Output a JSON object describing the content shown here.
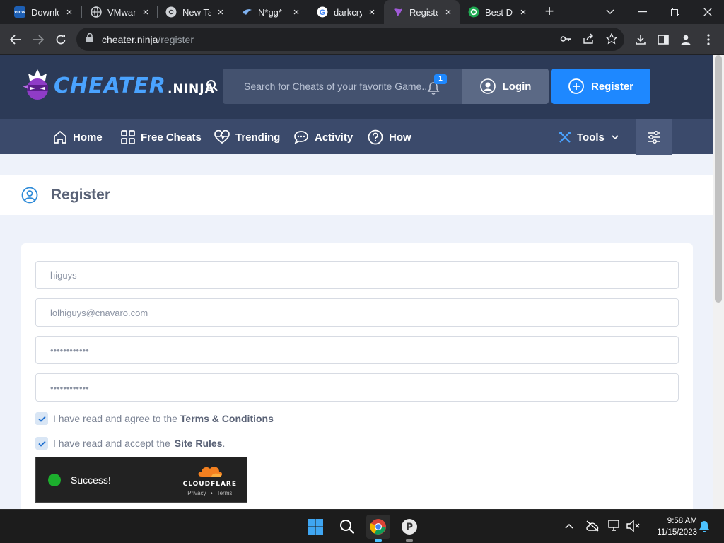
{
  "browser": {
    "tabs": [
      {
        "title": "Downlo",
        "favicon": "vmware-icon",
        "active": false
      },
      {
        "title": "VMwar",
        "favicon": "globe-icon",
        "active": false
      },
      {
        "title": "New Ta",
        "favicon": "chrome-icon",
        "active": false
      },
      {
        "title": "N*gg*",
        "favicon": "bird-icon",
        "active": false
      },
      {
        "title": "darkcry",
        "favicon": "google-icon",
        "active": false
      },
      {
        "title": "Registe",
        "favicon": "cheater-ninja-icon",
        "active": true
      },
      {
        "title": "Best Di",
        "favicon": "xbox-icon",
        "active": false
      }
    ],
    "url_host": "cheater.ninja",
    "url_path": "/register"
  },
  "site": {
    "logo_main": "CHEATER",
    "logo_sub": ".NINJA",
    "search_placeholder": "Search for Cheats of your favorite Game...",
    "notification_count": "1",
    "login_label": "Login",
    "register_label": "Register",
    "nav": [
      {
        "label": "Home",
        "icon": "home-icon"
      },
      {
        "label": "Free Cheats",
        "icon": "grid-icon"
      },
      {
        "label": "Trending",
        "icon": "heartbeat-icon"
      },
      {
        "label": "Activity",
        "icon": "chat-icon"
      },
      {
        "label": "How",
        "icon": "question-icon"
      }
    ],
    "tools_label": "Tools"
  },
  "page": {
    "title": "Register",
    "username": "higuys",
    "email": "lolhiguys@cnavaro.com",
    "password": "••••••••••••",
    "password_confirm": "••••••••••••",
    "terms_text": "I have read and agree to the",
    "terms_link": "Terms & Conditions",
    "rules_text": "I have read and accept the",
    "rules_link": "Site Rules",
    "rules_suffix": ".",
    "captcha_status": "Success!",
    "captcha_brand": "CLOUDFLARE",
    "captcha_privacy": "Privacy",
    "captcha_sep": "•",
    "captcha_terms": "Terms"
  },
  "taskbar": {
    "time": "9:58 AM",
    "date": "11/15/2023"
  },
  "colors": {
    "header_bg": "#2c3a57",
    "nav_bg": "#3b4a6b",
    "accent": "#1e88ff",
    "captcha_success": "#1cae2d"
  }
}
